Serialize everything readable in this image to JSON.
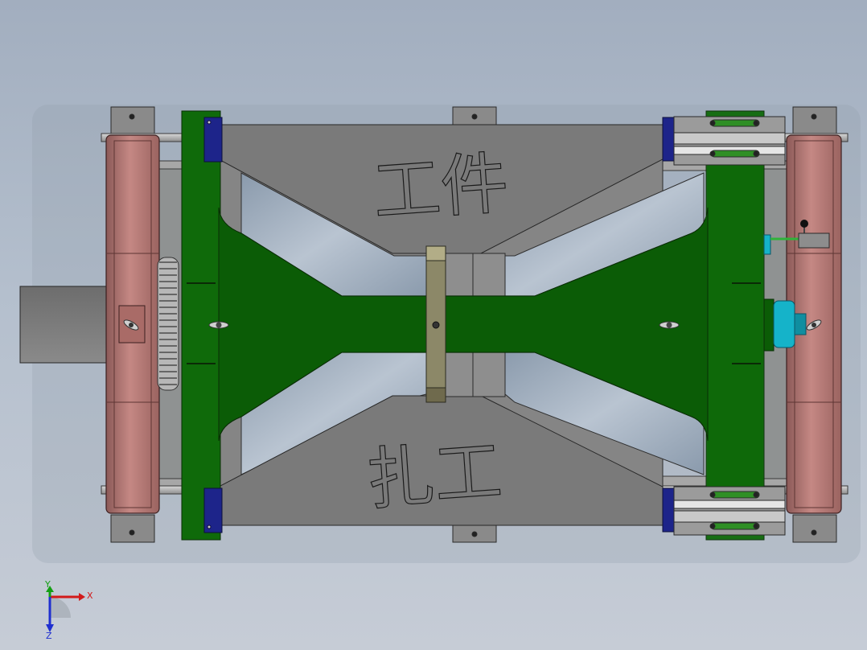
{
  "model": {
    "label_top": "工件",
    "label_bottom": "扎工"
  },
  "triad": {
    "x_label": "X",
    "y_label": "Y",
    "z_label": "Z"
  },
  "colors": {
    "background_top": "#a2aebf",
    "background_bottom": "#c6ccd6",
    "frame_gray": "#7c7c7c",
    "platform_green": "#0b5c06",
    "wheel_red": "#b77672",
    "clamp_blue": "#1d248a",
    "cyan_part": "#15b3c9"
  }
}
